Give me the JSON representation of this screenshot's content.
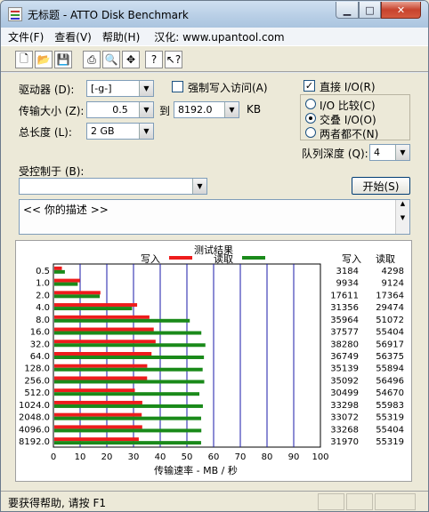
{
  "window": {
    "title": "无标题 - ATTO Disk Benchmark"
  },
  "menu": {
    "items": [
      "文件(F)",
      "查看(V)",
      "帮助(H)",
      "汉化: www.upantool.com"
    ]
  },
  "toolbar": {
    "icons": [
      "new-icon",
      "open-icon",
      "save-icon",
      "print-icon",
      "print-preview-icon",
      "move-icon",
      "help-icon",
      "context-help-icon"
    ]
  },
  "settings": {
    "drive_label": "驱动器 (D):",
    "drive_value": "[-g-]",
    "force_write_label": "强制写入访问(A)",
    "direct_io_label": "直接 I/O(R)",
    "transfer_label": "传输大小 (Z):",
    "transfer_from": "0.5",
    "transfer_to_label": "到",
    "transfer_to": "8192.0",
    "transfer_unit": "KB",
    "total_label": "总长度 (L):",
    "total_value": "2 GB",
    "io_compare": "I/O 比较(C)",
    "io_overlap": "交叠 I/O(O)",
    "io_none": "两者都不(N)",
    "queue_label": "队列深度 (Q):",
    "queue_value": "4",
    "controlled_label": "受控制于 (B):",
    "controlled_value": "",
    "start_button": "开始(S)",
    "description": "<<  你的描述  >>"
  },
  "results": {
    "title": "测试结果",
    "legend_write": "写入",
    "legend_read": "读取",
    "col_write": "写入",
    "col_read": "读取",
    "xlabel": "传输速率 - MB / 秒"
  },
  "chart_data": {
    "type": "bar",
    "orientation": "horizontal",
    "title": "测试结果",
    "xlabel": "传输速率 - MB / 秒",
    "xlim": [
      0,
      100
    ],
    "xticks": [
      0,
      10,
      20,
      30,
      40,
      50,
      60,
      70,
      80,
      90,
      100
    ],
    "categories": [
      "0.5",
      "1.0",
      "2.0",
      "4.0",
      "8.0",
      "16.0",
      "32.0",
      "64.0",
      "128.0",
      "256.0",
      "512.0",
      "1024.0",
      "2048.0",
      "4096.0",
      "8192.0"
    ],
    "series": [
      {
        "name": "写入",
        "color": "#ee1c1c",
        "values": [
          3.184,
          9.934,
          17.611,
          31.356,
          35.964,
          37.577,
          38.28,
          36.749,
          35.139,
          35.092,
          30.499,
          33.298,
          33.072,
          33.268,
          31.97
        ]
      },
      {
        "name": "读取",
        "color": "#1a8a1a",
        "values": [
          4.298,
          9.124,
          17.364,
          29.474,
          51.072,
          55.404,
          56.917,
          56.375,
          55.894,
          56.496,
          54.67,
          55.983,
          55.319,
          55.404,
          55.319
        ]
      }
    ],
    "table": {
      "write": [
        "3184",
        "9934",
        "17611",
        "31356",
        "35964",
        "37577",
        "38280",
        "36749",
        "35139",
        "35092",
        "30499",
        "33298",
        "33072",
        "33268",
        "31970"
      ],
      "read": [
        "4298",
        "9124",
        "17364",
        "29474",
        "51072",
        "55404",
        "56917",
        "56375",
        "55894",
        "56496",
        "54670",
        "55983",
        "55319",
        "55404",
        "55319"
      ]
    },
    "grid": true
  },
  "status": {
    "text": "要获得帮助, 请按 F1"
  }
}
